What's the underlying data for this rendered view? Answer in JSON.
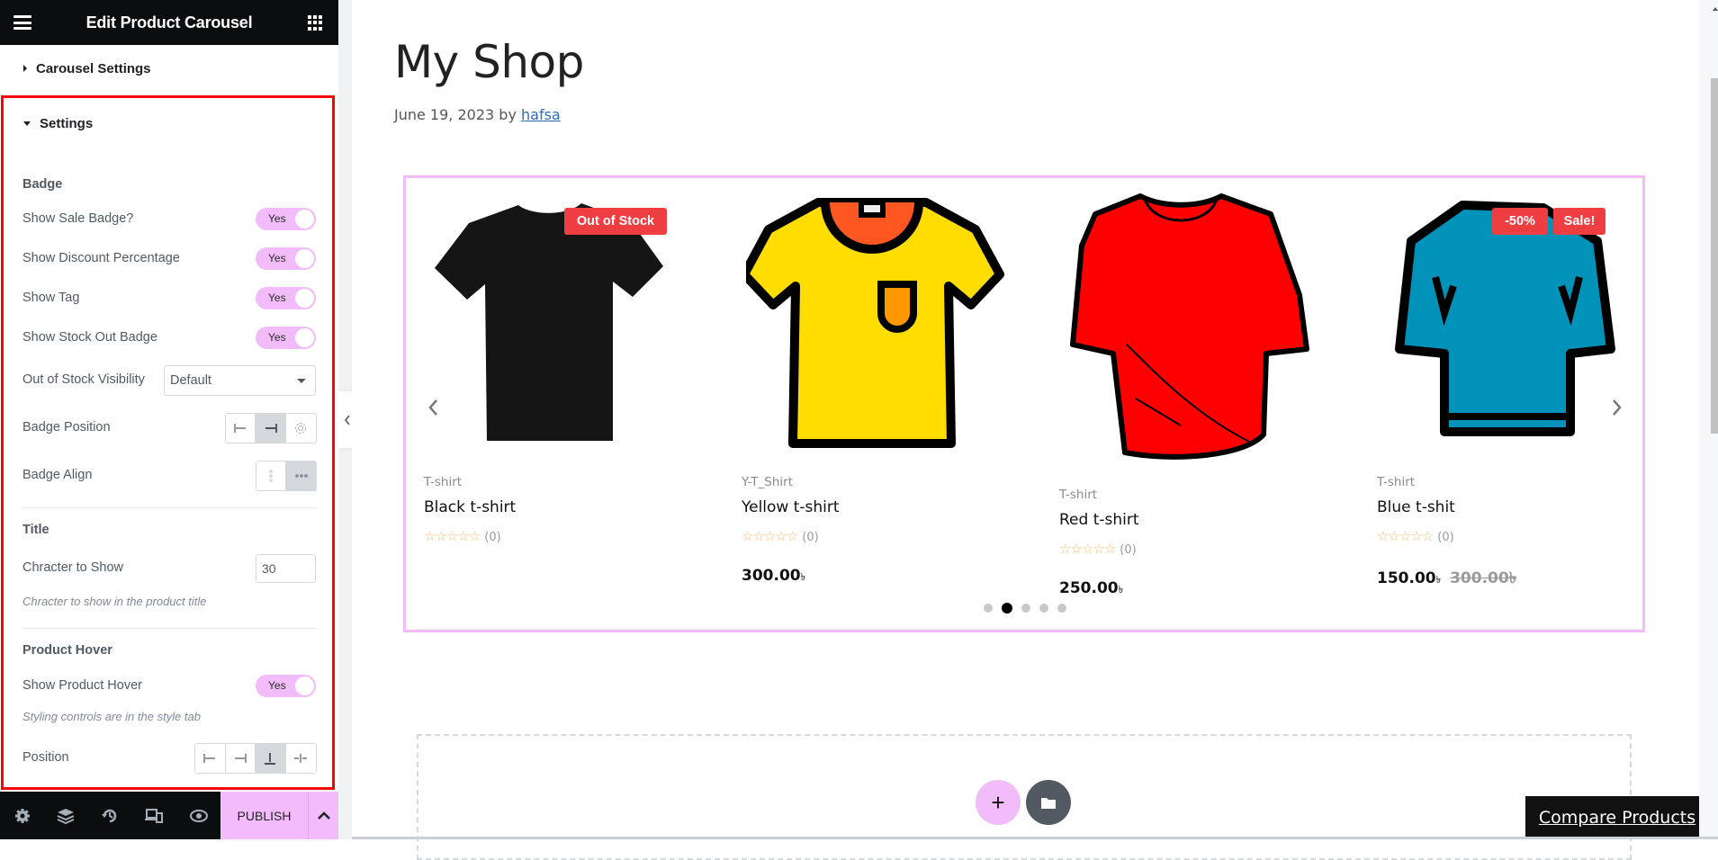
{
  "panel": {
    "title": "Edit Product Carousel",
    "sections": {
      "carousel_settings": "Carousel Settings",
      "settings": "Settings"
    },
    "badge": {
      "heading": "Badge",
      "show_sale_badge": {
        "label": "Show Sale Badge?",
        "value": "Yes"
      },
      "show_discount_percentage": {
        "label": "Show Discount Percentage",
        "value": "Yes"
      },
      "show_tag": {
        "label": "Show Tag",
        "value": "Yes"
      },
      "show_stock_out_badge": {
        "label": "Show Stock Out Badge",
        "value": "Yes"
      },
      "out_of_stock_visibility": {
        "label": "Out of Stock Visibility",
        "value": "Default"
      },
      "badge_position": {
        "label": "Badge Position",
        "options": [
          "align-left-icon",
          "align-right-icon",
          "custom-settings-icon"
        ],
        "selected": 1
      },
      "badge_align": {
        "label": "Badge Align",
        "options": [
          "vertical-dots-icon",
          "horizontal-dots-icon"
        ],
        "selected": 1
      }
    },
    "title_group": {
      "heading": "Title",
      "chars_to_show": {
        "label": "Chracter to Show",
        "value": "30"
      },
      "hint": "Chracter to show in the product title"
    },
    "product_hover": {
      "heading": "Product Hover",
      "show_product_hover": {
        "label": "Show Product Hover",
        "value": "Yes"
      },
      "hint": "Styling controls are in the style tab",
      "position": {
        "label": "Position",
        "options": [
          "left-icon",
          "right-icon",
          "bottom-icon",
          "center-icon"
        ],
        "selected": 2
      }
    },
    "footer": {
      "icons": [
        "settings-icon",
        "layers-icon",
        "history-icon",
        "responsive-icon",
        "preview-eye-icon"
      ],
      "publish_label": "PUBLISH"
    }
  },
  "page": {
    "title": "My Shop",
    "date": "June 19, 2023",
    "by": "by",
    "author": "hafsa"
  },
  "carousel": {
    "active_dot": 1,
    "dot_count": 5,
    "products": [
      {
        "category": "T-shirt",
        "name": "Black t-shirt",
        "rating_count": "(0)",
        "price": "",
        "currency": "",
        "old_price": "",
        "badges": [
          "Out of Stock"
        ],
        "color": "#151515"
      },
      {
        "category": "Y-T_Shirt",
        "name": "Yellow t-shirt",
        "rating_count": "(0)",
        "price": "300.00",
        "currency": "৳",
        "old_price": "",
        "badges": [],
        "color": "#ffdd00"
      },
      {
        "category": "T-shirt",
        "name": "Red t-shirt",
        "rating_count": "(0)",
        "price": "250.00",
        "currency": "৳",
        "old_price": "",
        "badges": [],
        "color": "#ff0000"
      },
      {
        "category": "T-shirt",
        "name": "Blue t-shit",
        "rating_count": "(0)",
        "price": "150.00",
        "currency": "৳",
        "old_price": "300.00৳",
        "badges": [
          "-50%",
          "Sale!"
        ],
        "color": "#0092b8"
      }
    ]
  },
  "compare_label": "Compare Products",
  "colors": {
    "accent": "#f2bbf9",
    "badge_red": "#ef3e42",
    "panel_dark": "#0c0d0e",
    "highlight_border": "#ff0000"
  }
}
